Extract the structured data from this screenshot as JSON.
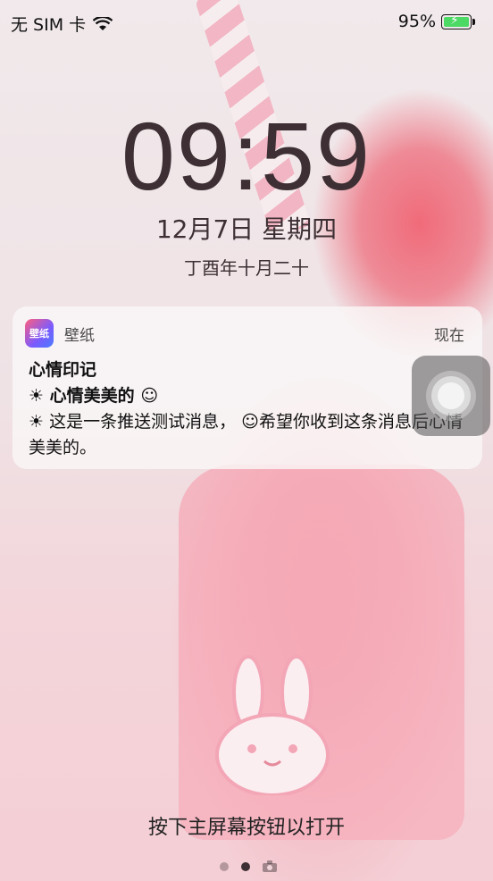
{
  "status_bar": {
    "carrier": "无 SIM 卡",
    "battery_percent": "95%",
    "battery_level": 0.95,
    "icons": [
      "wifi-icon",
      "battery-charging-icon"
    ]
  },
  "lockscreen": {
    "time": "09:59",
    "date": "12月7日 星期四",
    "lunar_date": "丁酉年十月二十"
  },
  "notification": {
    "app_name": "壁纸",
    "app_icon_text": "壁纸",
    "time": "现在",
    "title": "心情印记",
    "line1": "心情美美的",
    "line2": "这是一条推送测试消息，",
    "line3": "希望你收到这条消息后心情美美的。"
  },
  "footer": {
    "hint": "按下主屏幕按钮以打开",
    "page_dots": 2,
    "active_dot": 1
  },
  "colors": {
    "battery_fill": "#4cd964",
    "text_dark": "#3d2f33"
  }
}
